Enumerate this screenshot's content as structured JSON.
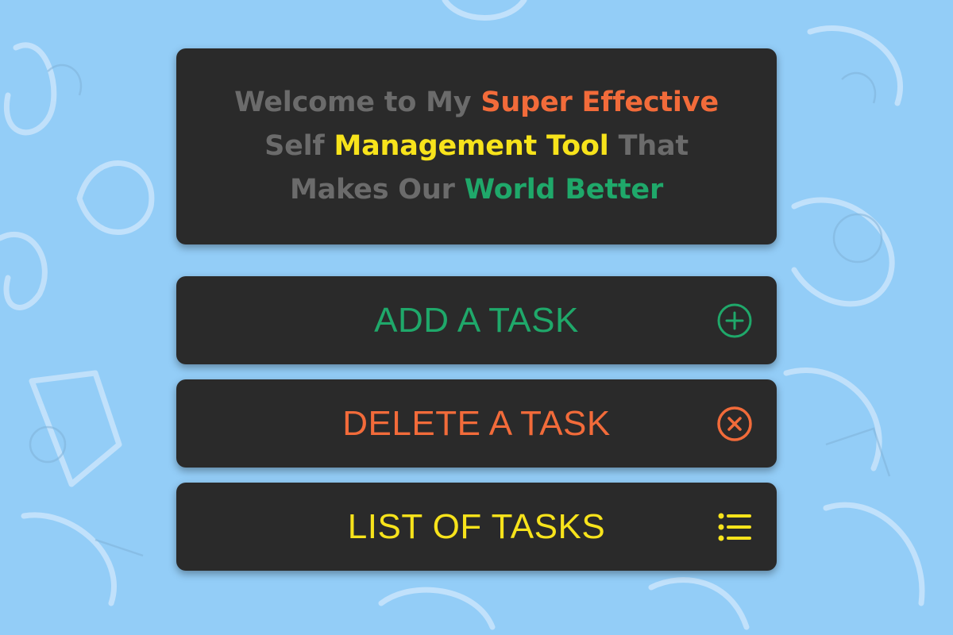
{
  "header": {
    "line1_plain": "Welcome to My ",
    "line1_highlight": "Super Effective",
    "line2_plain_start": "Self ",
    "line2_highlight": "Management Tool",
    "line2_plain_end": " That",
    "line3_plain": "Makes Our ",
    "line3_highlight": "World Better"
  },
  "actions": [
    {
      "label": "ADD A TASK",
      "icon": "plus-circle-icon",
      "color": "#1fa86a"
    },
    {
      "label": "DELETE A TASK",
      "icon": "close-circle-icon",
      "color": "#f26b3a"
    },
    {
      "label": "LIST OF TASKS",
      "icon": "list-icon",
      "color": "#f7e31b"
    }
  ],
  "colors": {
    "background": "#93cdf7",
    "card": "#2a2a2a",
    "text_muted": "#6b6b6b",
    "orange": "#f26b3a",
    "yellow": "#f7e31b",
    "green": "#1fa86a"
  }
}
